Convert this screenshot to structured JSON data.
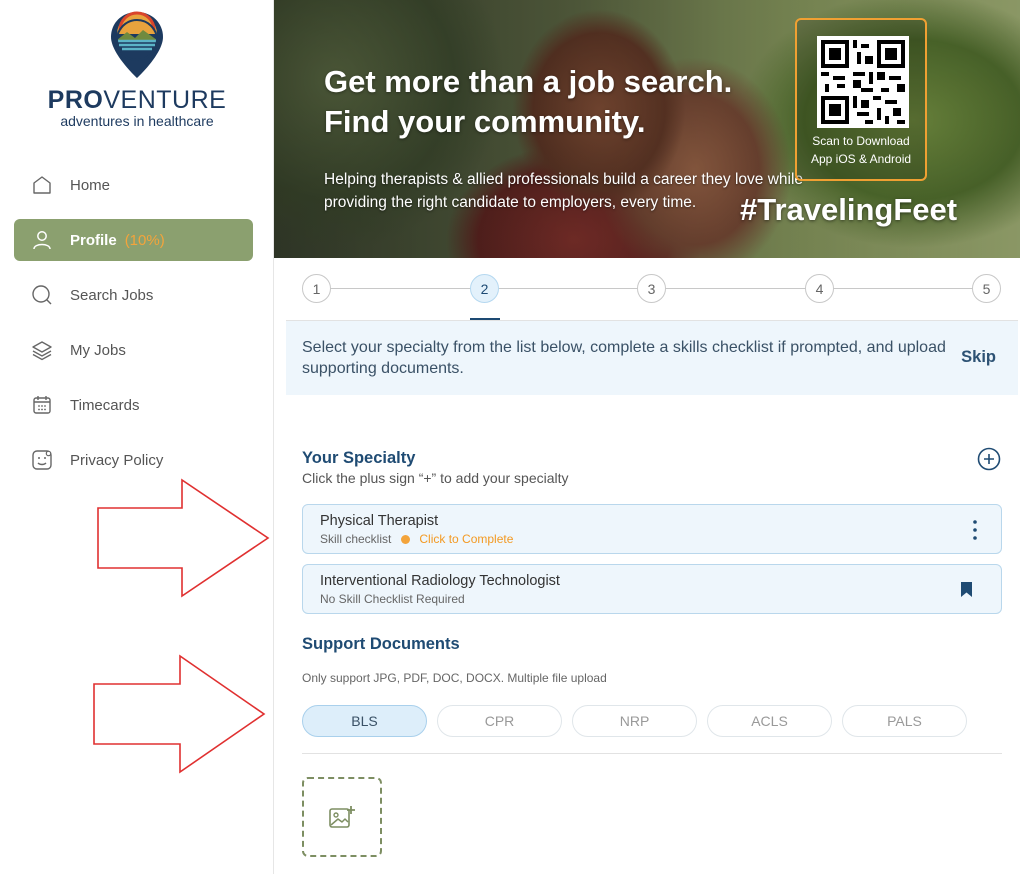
{
  "brand": {
    "name_bold": "PRO",
    "name_rest": "VENTURE",
    "tagline": "adventures in healthcare"
  },
  "nav": {
    "items": [
      {
        "label": "Home",
        "icon": "home-icon"
      },
      {
        "label": "Profile",
        "icon": "user-icon",
        "badge": "(10%)",
        "active": true
      },
      {
        "label": "Search Jobs",
        "icon": "search-icon"
      },
      {
        "label": "My Jobs",
        "icon": "layers-icon"
      },
      {
        "label": "Timecards",
        "icon": "calendar-icon"
      },
      {
        "label": "Privacy Policy",
        "icon": "privacy-icon"
      }
    ]
  },
  "banner": {
    "title_line1": "Get more than a job search.",
    "title_line2": "Find your community.",
    "subtitle": "Helping therapists & allied professionals build a career they love while providing the right candidate to employers, every time.",
    "hashtag": "#TravelingFeet",
    "qr_line1": "Scan to Download",
    "qr_line2": "App iOS & Android"
  },
  "stepper": {
    "steps": [
      "1",
      "2",
      "3",
      "4",
      "5"
    ],
    "active_index": 1
  },
  "info": {
    "text": "Select your specialty from the list below, complete a skills checklist if prompted, and upload supporting documents.",
    "skip_label": "Skip"
  },
  "specialty": {
    "title": "Your Specialty",
    "hint": "Click the plus sign “+” to add your specialty",
    "cards": [
      {
        "name": "Physical Therapist",
        "status": "Skill checklist",
        "action": "Click to Complete"
      },
      {
        "name": "Interventional Radiology Technologist",
        "status": "No Skill Checklist Required"
      }
    ]
  },
  "documents": {
    "title": "Support Documents",
    "note": "Only support JPG, PDF, DOC, DOCX. Multiple file upload",
    "tabs": [
      "BLS",
      "CPR",
      "NRP",
      "ACLS",
      "PALS"
    ],
    "active_tab": "BLS"
  },
  "colors": {
    "nav_active": "#8ba06f",
    "accent_orange": "#f3a43b",
    "navy": "#1f4b73",
    "arrow_red": "#e03030"
  }
}
